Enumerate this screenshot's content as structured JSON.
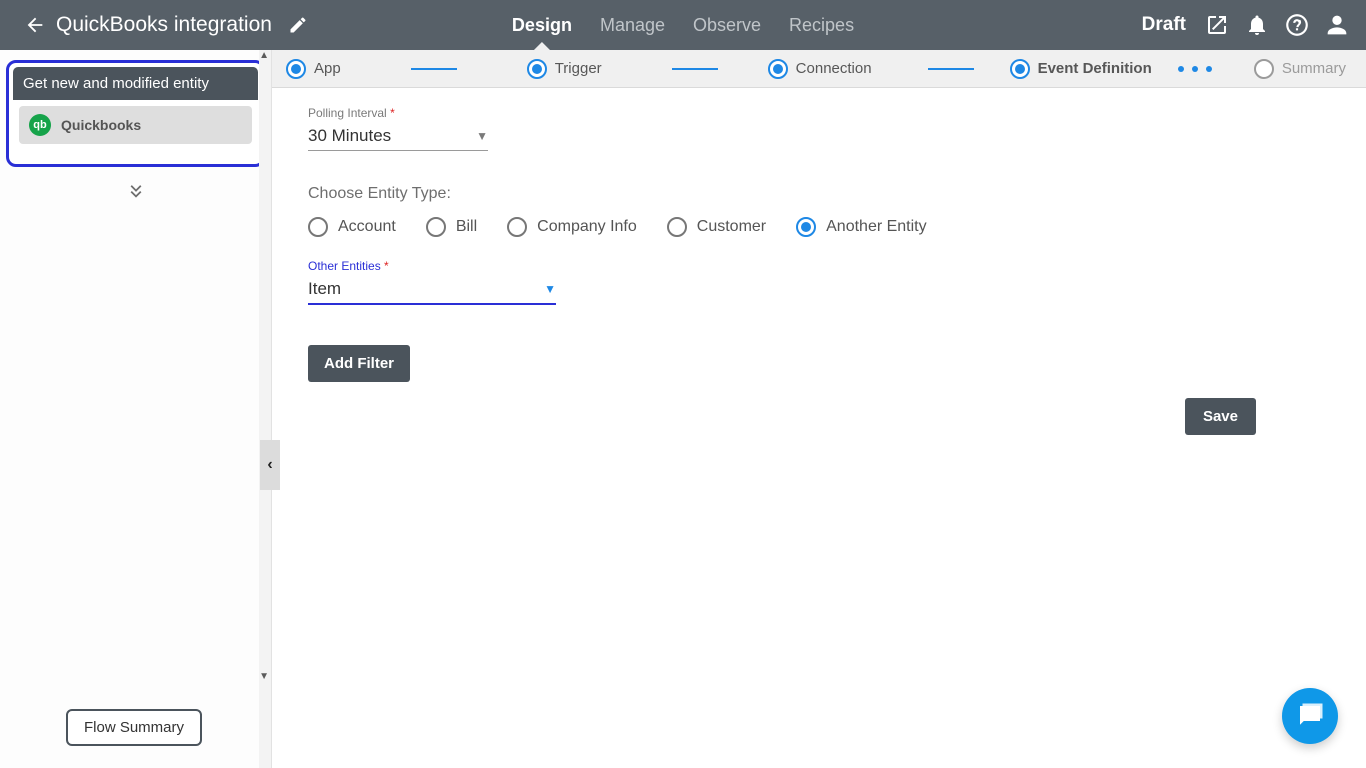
{
  "header": {
    "title": "QuickBooks integration",
    "status": "Draft",
    "tabs": [
      "Design",
      "Manage",
      "Observe",
      "Recipes"
    ],
    "active_tab": "Design"
  },
  "steps": {
    "s1": "App",
    "s2": "Trigger",
    "s3": "Connection",
    "s4": "Event Definition",
    "s5": "Summary"
  },
  "sidebar": {
    "card_title": "Get new and modified entity",
    "app_name": "Quickbooks",
    "qb_abbrev": "qb",
    "flow_summary_label": "Flow Summary",
    "collapse_glyph": "‹"
  },
  "form": {
    "polling_label": "Polling Interval",
    "polling_value": "30 Minutes",
    "choose_entity_label": "Choose Entity Type:",
    "entities": {
      "e1": "Account",
      "e2": "Bill",
      "e3": "Company Info",
      "e4": "Customer",
      "e5": "Another Entity"
    },
    "selected_entity": "Another Entity",
    "other_entities_label": "Other Entities",
    "other_entities_value": "Item",
    "add_filter_label": "Add Filter",
    "save_label": "Save"
  },
  "glyphs": {
    "required": "*",
    "chevrons_down": "»"
  }
}
